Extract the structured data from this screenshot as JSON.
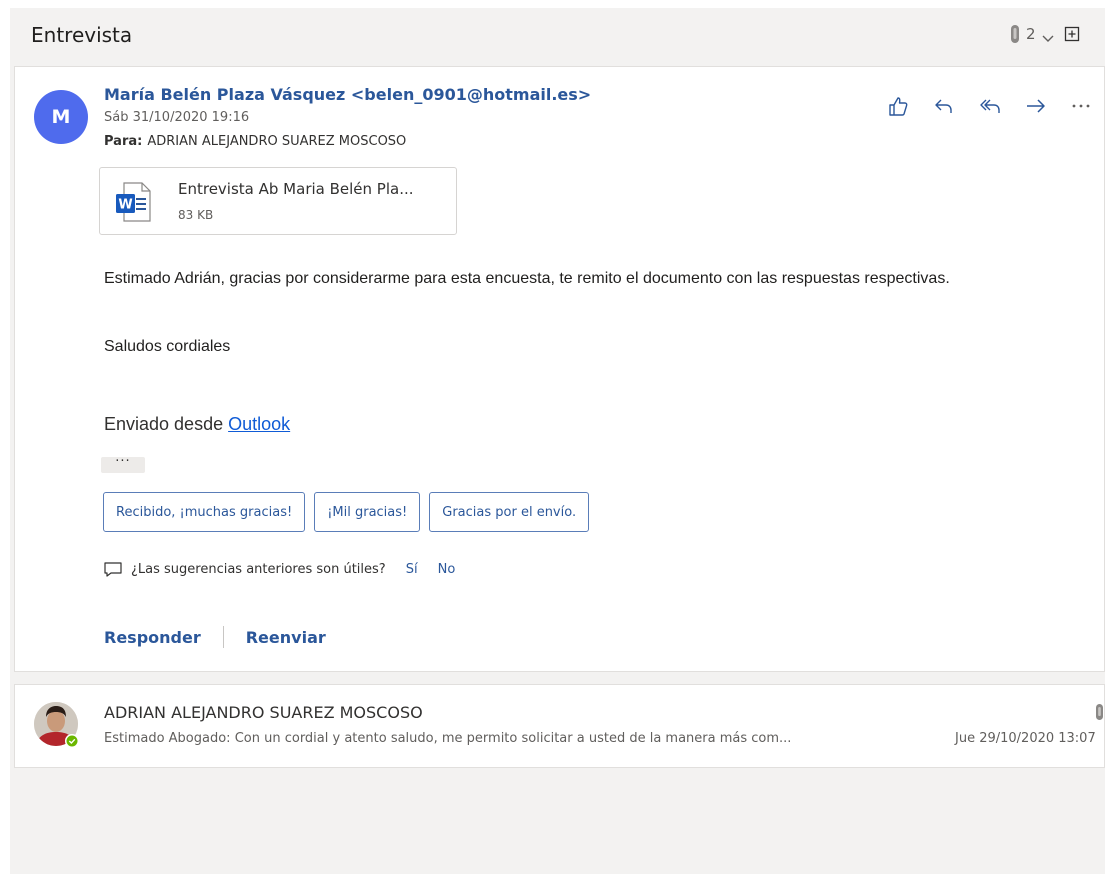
{
  "thread": {
    "title": "Entrevista",
    "attachment_count": "2"
  },
  "message": {
    "avatar_initial": "M",
    "sender": "María Belén Plaza Vásquez <belen_0901@hotmail.es>",
    "date": "Sáb 31/10/2020 19:16",
    "to_label": "Para:",
    "to_value": "ADRIAN ALEJANDRO SUAREZ MOSCOSO",
    "attachment": {
      "name": "Entrevista Ab Maria Belén Pla...",
      "size": "83 KB",
      "icon": "word-document-icon"
    },
    "body": "Estimado Adrián, gracias por considerarme para esta encuesta, te remito el documento con las respuestas respectivas.",
    "closing": "Saludos cordiales",
    "sent_from_prefix": "Enviado desde",
    "sent_from_link": "Outlook",
    "ellipsis": "···",
    "actions": [
      "like-icon",
      "reply-icon",
      "reply-all-icon",
      "forward-icon",
      "more-icon"
    ]
  },
  "suggestions": [
    "Recibido, ¡muchas gracias!",
    "¡Mil gracias!",
    "Gracias por el envío."
  ],
  "feedback": {
    "question": "¿Las sugerencias anteriores son útiles?",
    "yes": "Sí",
    "no": "No"
  },
  "reply_actions": {
    "reply": "Responder",
    "forward": "Reenviar"
  },
  "previous_message": {
    "sender": "ADRIAN ALEJANDRO SUAREZ MOSCOSO",
    "preview": "Estimado Abogado: Con un cordial y atento saludo, me permito solicitar a usted de la manera más com...",
    "date": "Jue 29/10/2020 13:07",
    "status": "online"
  },
  "colors": {
    "accent": "#2b579a",
    "avatar": "#4f6bed",
    "link": "#0f5bd6",
    "presence": "#6bb700"
  }
}
